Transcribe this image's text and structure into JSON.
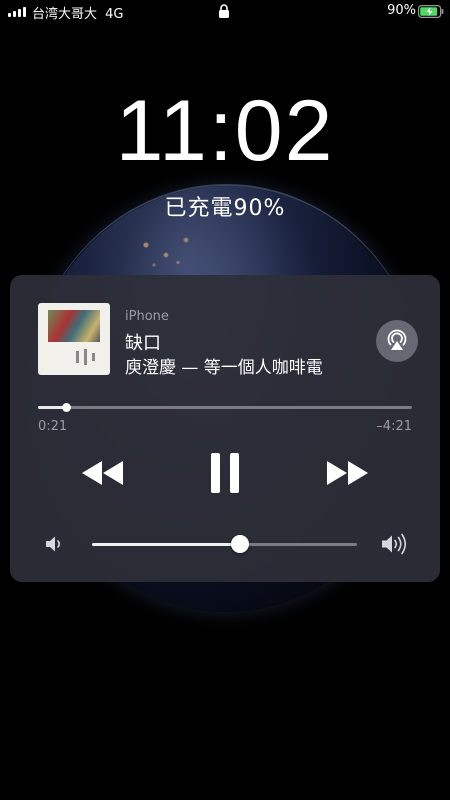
{
  "status_bar": {
    "carrier": "台湾大哥大",
    "network": "4G",
    "battery_percent": "90%",
    "battery_level": 0.9,
    "charging": true,
    "signal_bars": 4
  },
  "lock_screen": {
    "time": "11:02",
    "charging_text": "已充電90%"
  },
  "now_playing": {
    "source": "iPhone",
    "title": "缺口",
    "subtitle": "庾澄慶 — 等一個人咖啡電",
    "elapsed": "0:21",
    "remaining": "–4:21",
    "progress_fraction": 0.075,
    "volume_fraction": 0.56,
    "is_playing": true
  },
  "icons": {
    "lock": "lock-icon",
    "battery": "battery-charging-icon",
    "airplay": "airplay-icon",
    "rewind": "rewind-icon",
    "pause": "pause-icon",
    "forward": "fast-forward-icon",
    "volume_low": "volume-low-icon",
    "volume_high": "volume-high-icon"
  },
  "colors": {
    "battery_fill": "#4cd964",
    "card_background": "#2d2e38"
  }
}
